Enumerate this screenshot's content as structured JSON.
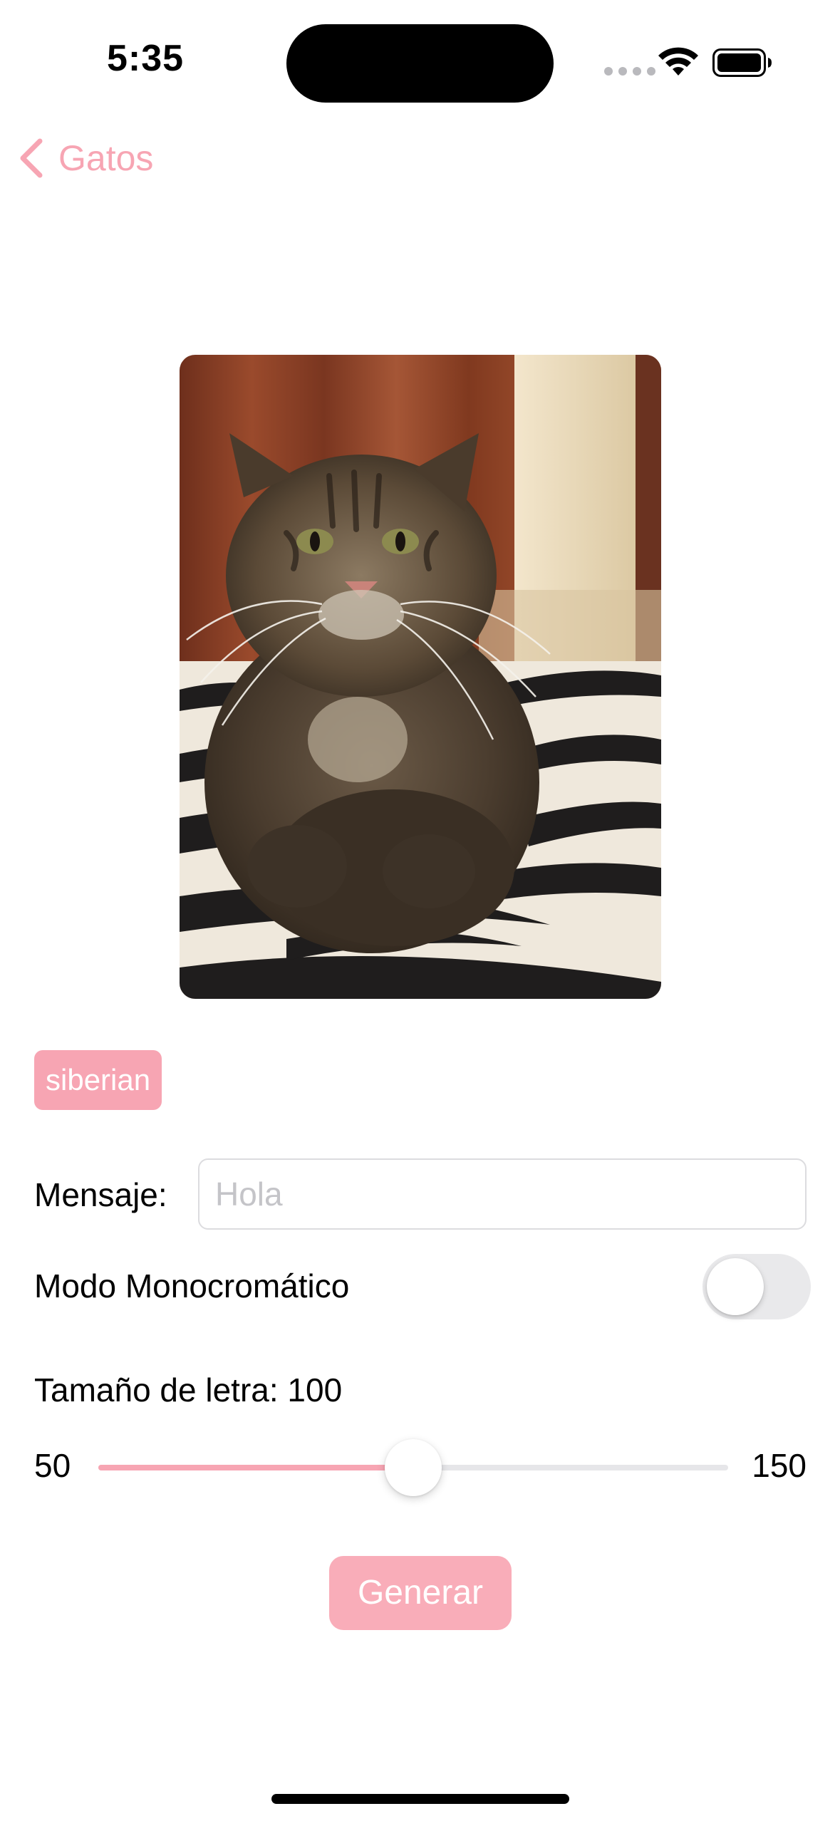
{
  "status_bar": {
    "time": "5:35"
  },
  "nav": {
    "back_label": "Gatos"
  },
  "cat": {
    "breed_tag": "siberian"
  },
  "form": {
    "message_label": "Mensaje:",
    "message_value": "",
    "message_placeholder": "Hola",
    "monochrome_label": "Modo Monocromático",
    "monochrome_on": false,
    "font_size_label": "Tamaño de letra: 100",
    "slider": {
      "min": 50,
      "max": 150,
      "value": 100,
      "min_label": "50",
      "max_label": "150"
    },
    "generate_label": "Generar"
  },
  "colors": {
    "accent": "#f7a5b3",
    "toggle_off": "#e9e9eb"
  }
}
